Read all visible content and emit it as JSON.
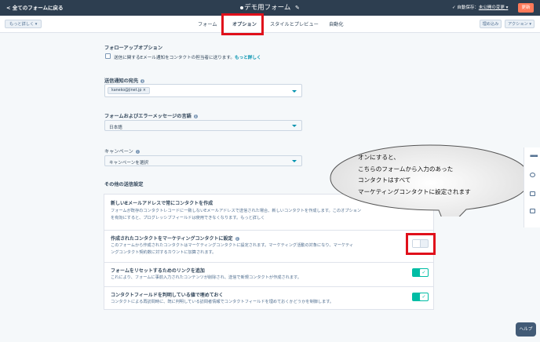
{
  "header": {
    "back_label": "< 全てのフォームに戻る",
    "form_title": "デモ用フォーム",
    "autosave_prefix": "✓ 自動保存：",
    "autosave_status": "未公開の変更 ▾",
    "update_label": "更新"
  },
  "toolbar": {
    "more_label": "もっと詳しく ▾",
    "tabs": [
      "フォーム",
      "オプション",
      "スタイルとプレビュー",
      "自動化"
    ],
    "active_tab": "オプション",
    "embed_label": "埋め込み",
    "action_label": "アクション ▾"
  },
  "followup": {
    "heading": "フォローアップオプション",
    "checkbox_label": "送信に関するEメール通知をコンタクトの担当者に送ります。",
    "learn_more": "もっと詳しく"
  },
  "notification": {
    "heading": "送信通知の宛先",
    "recipient_chip": "kaneko@jinet.jp ×"
  },
  "language": {
    "heading": "フォームおよびエラーメッセージの言語",
    "value": "日本語"
  },
  "campaign": {
    "heading": "キャンペーン",
    "placeholder": "キャンペーンを選択"
  },
  "other_settings": {
    "heading": "その他の送信設定",
    "rows": [
      {
        "title": "新しいEメールアドレスで常にコンタクトを作成",
        "desc1": "フォームが既存のコンタクトレコードに一致しないEメールアドレスで送信された場合、新しいコンタクトを作成します。このオプション",
        "desc2": "を有効にすると、プログレッシブフィールドは使用できなくなります。もっと詳しく"
      },
      {
        "title": "作成されたコンタクトをマーケティングコンタクトに設定",
        "desc1": "このフォームから作成されたコンタクトはマーケティングコンタクトに設定されます。マーケティング活動の対象になり、マーケティ",
        "desc2": "ングコンタクト契約数に対するカウントに加算されます。",
        "enabled": false
      },
      {
        "title": "フォームをリセットするためのリンクを追加",
        "desc1": "これにより、フォームに事前入力されたコンテンツが削除され、送信で新規コンタクトが作成されます。",
        "enabled": true
      },
      {
        "title": "コンタクトフィールドを判明している値で埋めておく",
        "desc1": "コンタクトによる再訪問時に、既に判明している訪問者情報でコンタクトフィールドを埋めておくかどうかを制御します。",
        "enabled": true
      }
    ]
  },
  "callout": {
    "lines": [
      "オンにすると、",
      "こちらのフォームから入力のあった",
      "コンタクトはすべて",
      "マーケティングコンタクトに設定されます"
    ]
  },
  "help_label": "ヘルプ",
  "colors": {
    "topbar": "#2d3e50",
    "accent_orange": "#ff7a59",
    "toggle_on": "#00bda5",
    "highlight_red": "#e0101b",
    "link": "#0091ae"
  }
}
